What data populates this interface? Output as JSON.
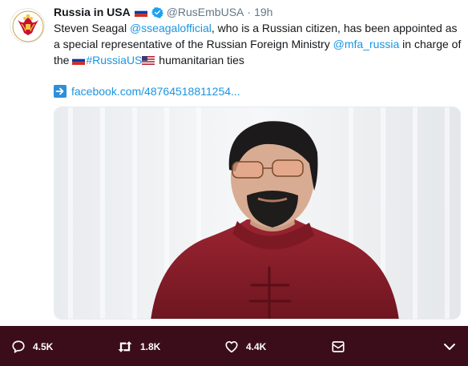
{
  "tweet": {
    "display_name": "Russia in USA",
    "handle": "@RusEmbUSA",
    "separator": "·",
    "time": "19h",
    "text_part1": "Steven Seagal ",
    "mention1": "@sseagalofficial",
    "text_part2": ", who is a Russian citizen, has been appointed as a special representative of the Russian Foreign Ministry ",
    "mention2": "@mfa_russia",
    "text_part3": " in charge of the ",
    "hashtag": "#RussiaUS",
    "text_part4": " humanitarian ties",
    "link_text": "facebook.com/48764518811254..."
  },
  "actions": {
    "reply_count": "4.5K",
    "retweet_count": "1.8K",
    "like_count": "4.4K"
  },
  "colors": {
    "link": "#1b95e0",
    "action_bar": "#3b0d1b",
    "verified": "#1da1f2",
    "jacket": "#8e1f2b"
  },
  "icons": {
    "reply": "reply-icon",
    "retweet": "retweet-icon",
    "like": "heart-icon",
    "dm": "envelope-icon",
    "more": "chevron-down-icon",
    "verified": "verified-badge-icon",
    "link_arrow": "right-arrow-icon"
  }
}
